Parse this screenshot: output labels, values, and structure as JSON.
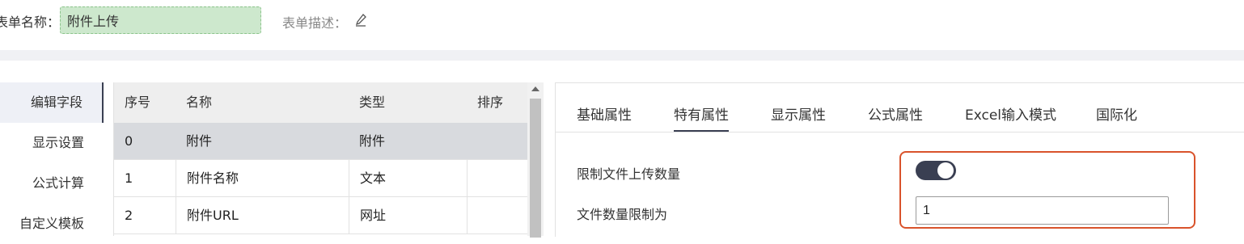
{
  "header": {
    "form_name_label": "表单名称：",
    "form_name_value": "附件上传",
    "form_desc_label": "表单描述："
  },
  "side_menu": {
    "items": [
      {
        "label": "编辑字段",
        "active": true
      },
      {
        "label": "显示设置",
        "active": false
      },
      {
        "label": "公式计算",
        "active": false
      },
      {
        "label": "自定义模板",
        "active": false
      }
    ]
  },
  "field_table": {
    "columns": [
      "序号",
      "名称",
      "类型",
      "排序"
    ],
    "rows": [
      {
        "index": "0",
        "name": "附件",
        "type": "附件",
        "sort": "",
        "selected": true
      },
      {
        "index": "1",
        "name": "附件名称",
        "type": "文本",
        "sort": "",
        "selected": false
      },
      {
        "index": "2",
        "name": "附件URL",
        "type": "网址",
        "sort": "",
        "selected": false
      }
    ]
  },
  "panel": {
    "tabs": [
      {
        "label": "基础属性",
        "active": false
      },
      {
        "label": "特有属性",
        "active": true
      },
      {
        "label": "显示属性",
        "active": false
      },
      {
        "label": "公式属性",
        "active": false
      },
      {
        "label": "Excel输入模式",
        "active": false
      },
      {
        "label": "国际化",
        "active": false
      }
    ],
    "limit_upload_label": "限制文件上传数量",
    "limit_upload_enabled": true,
    "file_limit_label": "文件数量限制为",
    "file_limit_value": "1"
  },
  "colors": {
    "accent": "#3a3f52",
    "highlight": "#d9532b",
    "form_name_bg": "#cde8cd"
  },
  "icons": {
    "edit": "pencil-icon",
    "scroll_up": "arrow-up-icon"
  }
}
